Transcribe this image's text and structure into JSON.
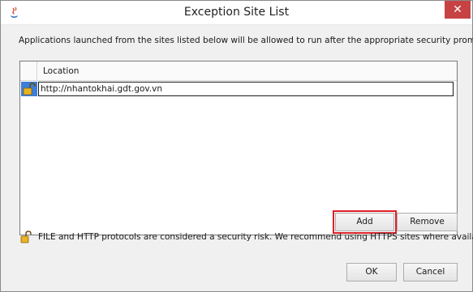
{
  "window": {
    "title": "Exception Site List",
    "close_glyph": "✕"
  },
  "intro_text": "Applications launched from the sites listed below will be allowed to run after the appropriate security prompts.",
  "table": {
    "column_header": "Location",
    "rows": [
      {
        "location": "http://nhantokhai.gdt.gov.vn",
        "icon": "unlocked-padlock-icon"
      }
    ]
  },
  "buttons": {
    "add": "Add",
    "remove": "Remove",
    "ok": "OK",
    "cancel": "Cancel"
  },
  "warning": {
    "icon": "unlocked-padlock-icon",
    "text": "FILE and HTTP protocols are considered a security risk.  We recommend using HTTPS sites where available."
  },
  "colors": {
    "highlight_box": "#e01f26",
    "selected_row": "#3b7fd6",
    "close_button": "#c74343"
  }
}
